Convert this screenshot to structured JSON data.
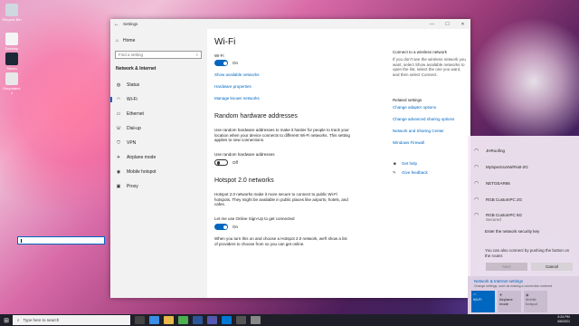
{
  "desktop": {
    "icons": [
      "Recycle Bin",
      "",
      "Desktop",
      "Steam",
      "Dsupdate4 1"
    ]
  },
  "settings": {
    "window_title": "Settings",
    "home_label": "Home",
    "search_placeholder": "Find a setting",
    "section_title": "Network & Internet",
    "nav_items": [
      "Status",
      "Wi-Fi",
      "Ethernet",
      "Dial-up",
      "VPN",
      "Airplane mode",
      "Mobile hotspot",
      "Proxy"
    ],
    "page_title": "Wi-Fi",
    "wifi_label": "Wi-Fi",
    "wifi_state": "On",
    "links": [
      "Show available networks",
      "Hardware properties",
      "Manage known networks"
    ],
    "random_hw_title": "Random hardware addresses",
    "random_hw_desc": "Use random hardware addresses to make it harder for people to track your location when your device connects to different Wi-Fi networks. This setting applies to new connections.",
    "random_hw_toggle_label": "Use random hardware addresses",
    "random_hw_state": "Off",
    "hotspot_title": "Hotspot 2.0 networks",
    "hotspot_desc": "Hotspot 2.0 networks make it more secure to connect to public Wi-Fi hotspots. They might be available in public places like airports, hotels, and cafes.",
    "hotspot_toggle_label": "Let me use Online Sign-Up to get connected",
    "hotspot_state": "On",
    "hotspot_note": "When you turn this on and choose a Hotspot 2.0 network, we'll show a list of providers to choose from so you can get online.",
    "connect_title": "Connect to a wireless network",
    "connect_desc": "If you don't see the wireless network you want, select Show available networks to open the list, select the one you want, and then select Connect.",
    "related_title": "Related settings",
    "related_links": [
      "Change adapter options",
      "Change advanced sharing options",
      "Network and Sharing Center",
      "Windows Firewall"
    ],
    "help_links": [
      "Get help",
      "Give feedback"
    ]
  },
  "flyout": {
    "networks": [
      {
        "name": "JHRoofing",
        "status": ""
      },
      {
        "name": "MySpectrumWiFia0-2G",
        "status": ""
      },
      {
        "name": "NETGEAR66",
        "status": ""
      },
      {
        "name": "RGB CustomPC 2G",
        "status": ""
      },
      {
        "name": "RGB CustomPC 5G",
        "status": "Secured"
      }
    ],
    "key_prompt": "Enter the network security key",
    "router_note": "You can also connect by pushing the button on the router.",
    "next_label": "Next",
    "cancel_label": "Cancel",
    "settings_link": "Network & Internet settings",
    "settings_note": "Change settings, such as making a connection metered.",
    "tiles": [
      "Wi-Fi",
      "Airplane mode",
      "Mobile hotspot"
    ]
  },
  "taskbar": {
    "search_placeholder": "Type here to search",
    "time": "3:24 PM",
    "date": "4/6/2021"
  },
  "colors": {
    "accent": "#0067c0",
    "nav_bg": "#f2f2f2"
  }
}
